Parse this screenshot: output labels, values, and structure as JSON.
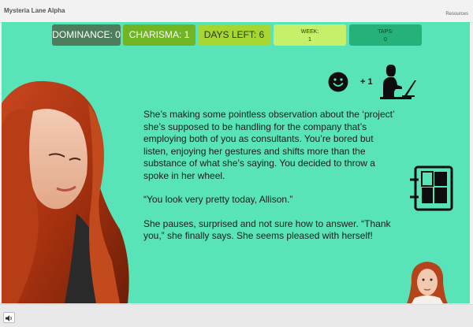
{
  "app": {
    "title": "Mysteria Lane Alpha",
    "resources_label": "Resources"
  },
  "stats": {
    "dominance": "DOMINANCE: 0",
    "charisma": "CHARISMA: 1",
    "days_left": "DAYS LEFT: 6",
    "week_label": "WEEK:",
    "week_value": "1",
    "taps_label": "TAPS:",
    "taps_value": "0"
  },
  "reward": {
    "text": "+ 1"
  },
  "story": {
    "paragraphs": [
      "She’s making some pointless observation about the ‘project’ she’s supposed to be handling for the company that’s employing both of you as consultants.  You’re bored but listen, enjoying her gestures and shifts more than the substance of what she’s saying.  You decided to throw a spoke in her wheel.",
      "“You look very pretty today, Allison.”",
      "She pauses, surprised and not sure how to  answer.  “Thank you,” she finally says.  She seems pleased with herself!"
    ]
  },
  "icons": {
    "smiley": "smiley-icon",
    "worker": "woman-at-laptop-icon",
    "board": "board-grid-icon",
    "volume": "speaker-icon"
  },
  "colors": {
    "stage_bg": "#58e4b8",
    "dominance_bg": "#4e7d5e",
    "charisma_bg": "#70b524",
    "days_bg": "#a5d632",
    "week_bg": "#c6f06a",
    "taps_bg": "#26b07a"
  }
}
